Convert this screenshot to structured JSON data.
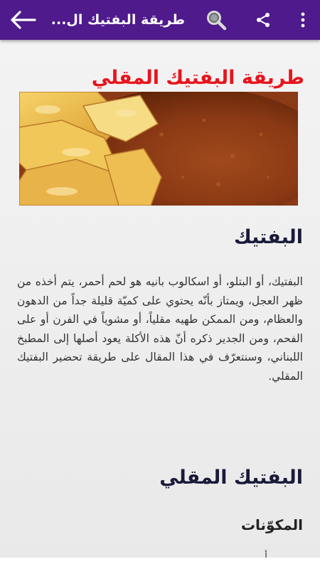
{
  "appbar": {
    "title": "طريقة البفتيك ال...",
    "background": "#4e1a8c",
    "icons": [
      "back-arrow-icon",
      "search-icon",
      "share-icon",
      "more-vert-icon"
    ]
  },
  "article": {
    "title": "طريقة البفتيك المقلي",
    "title_color": "#e8141c",
    "hero_image": "fried-steak-with-chips-photo",
    "section1_heading": "البفتيك",
    "section1_text": "البفتيك، أو البتلو، أو اسكالوب بانيه هو لحم أحمر، يتم أخذه من ظهر العجل، ويمتاز بأنّه يحتوي على كميّة قليلة جداً من الدهون والعظام، ومن الممكن طهيه مقلياً، أو مشوياً في الفرن أو على الفحم، ومن الجدير ذكره أنّ هذه الأكلة يعود أصلها إلى المطبخ اللبناني، وسنتعرّف في هذا المقال على طريقة تحضير البفتيك المقلي.",
    "section2_heading": "البفتيك المقلي",
    "section3_heading": "المكوّنات",
    "partial_text": "أ"
  }
}
